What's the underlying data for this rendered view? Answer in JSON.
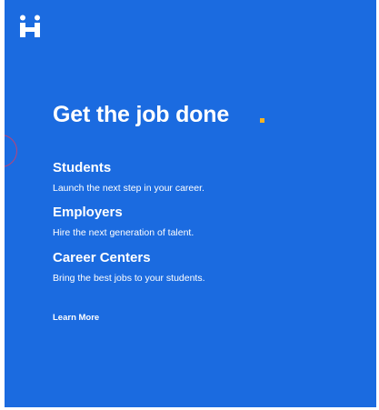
{
  "brand": {
    "logo_icon": "handshake-logo-icon",
    "accent_color": "#f6b322",
    "background_color": "#1b6be0"
  },
  "headline": "Get the job done",
  "sections": [
    {
      "title": "Students",
      "description": "Launch the next step in your career."
    },
    {
      "title": "Employers",
      "description": "Hire the next generation of talent."
    },
    {
      "title": "Career Centers",
      "description": "Bring the best jobs to your students."
    }
  ],
  "cta": {
    "label": "Learn More"
  }
}
